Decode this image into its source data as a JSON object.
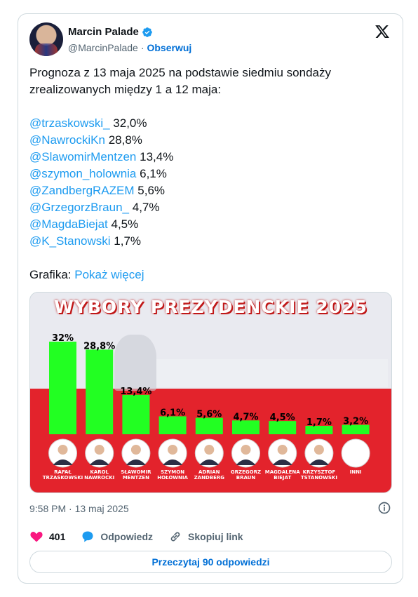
{
  "author": {
    "display_name": "Marcin Palade",
    "handle": "@MarcinPalade",
    "separator": "·",
    "follow_label": "Obserwuj"
  },
  "tweet": {
    "intro": "Prognoza z 13 maja 2025 na podstawie siedmiu sondaży zrealizowanych między 1 a 12 maja:",
    "mentions": [
      {
        "handle": "@trzaskowski_",
        "value": "32,0%"
      },
      {
        "handle": "@NawrockiKn",
        "value": "28,8%"
      },
      {
        "handle": "@SlawomirMentzen",
        "value": "13,4%"
      },
      {
        "handle": "@szymon_holownia",
        "value": "6,1%"
      },
      {
        "handle": "@ZandbergRAZEM",
        "value": "5,6%"
      },
      {
        "handle": "@GrzegorzBraun_",
        "value": "4,7%"
      },
      {
        "handle": "@MagdaBiejat",
        "value": "4,5%"
      },
      {
        "handle": "@K_Stanowski",
        "value": "1,7%"
      }
    ],
    "graphic_label": "Grafika:",
    "show_more": "Pokaż więcej"
  },
  "chart_data": {
    "type": "bar",
    "title": "WYBORY PREZYDENCKIE 2025",
    "categories": [
      "RAFAŁ TRZASKOWSKI",
      "KAROL NAWROCKI",
      "SŁAWOMIR MENTZEN",
      "SZYMON HOŁOWNIA",
      "ADRIAN ZANDBERG",
      "GRZEGORZ BRAUN",
      "MAGDALENA BIEJAT",
      "KRZYSZTOF TSTANOWSKI",
      "INNI"
    ],
    "name_lines": [
      [
        "RAFAŁ",
        "TRZASKOWSKI"
      ],
      [
        "KAROL",
        "NAWROCKI"
      ],
      [
        "SŁAWOMIR",
        "MENTZEN"
      ],
      [
        "SZYMON",
        "HOŁOWNIA"
      ],
      [
        "ADRIAN",
        "ZANDBERG"
      ],
      [
        "GRZEGORZ",
        "BRAUN"
      ],
      [
        "MAGDALENA",
        "BIEJAT"
      ],
      [
        "KRZYSZTOF",
        "TSTANOWSKI"
      ],
      [
        "INNI"
      ]
    ],
    "values": [
      32,
      28.8,
      13.4,
      6.1,
      5.6,
      4.7,
      4.5,
      1.7,
      3.2
    ],
    "labels": [
      "32%",
      "28,8%",
      "13,4%",
      "6,1%",
      "5,6%",
      "4,7%",
      "4,5%",
      "1,7%",
      "3,2%"
    ],
    "bar_color": "#22ff22",
    "ylim": [
      0,
      35
    ]
  },
  "meta": {
    "timestamp": "9:58 PM · 13 maj 2025"
  },
  "actions": {
    "like_count": "401",
    "reply_label": "Odpowiedz",
    "copy_link_label": "Skopiuj link",
    "read_replies_label": "Przeczytaj 90 odpowiedzi"
  },
  "colors": {
    "accent": "#1d9bf0",
    "like": "#f91880",
    "background_red": "#e3232c"
  }
}
